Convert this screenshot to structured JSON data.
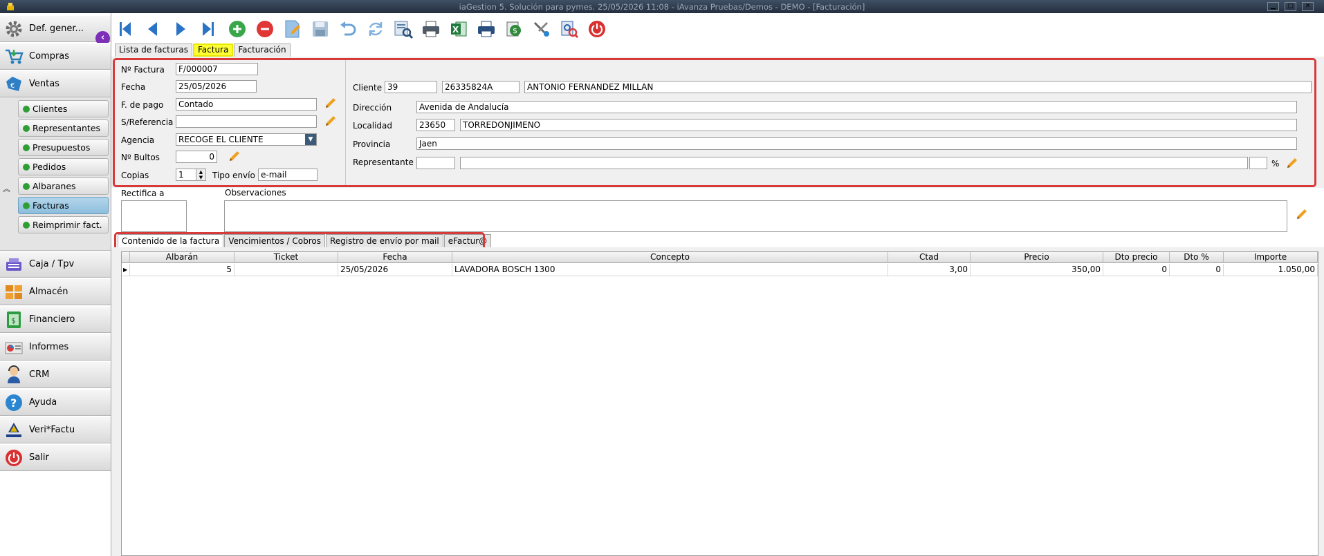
{
  "window": {
    "title": "iaGestion 5. Solución para pymes.   25/05/2026 11:08   -   iAvanza Pruebas/Demos - DEMO - [Facturación]"
  },
  "sidebar": {
    "main_items": [
      {
        "label": "Def. gener...",
        "icon": "gear-icon"
      },
      {
        "label": "Compras",
        "icon": "cart-icon"
      },
      {
        "label": "Ventas",
        "icon": "sales-icon"
      },
      {
        "label": "Caja / Tpv",
        "icon": "cash-register-icon"
      },
      {
        "label": "Almacén",
        "icon": "warehouse-icon"
      },
      {
        "label": "Financiero",
        "icon": "money-icon"
      },
      {
        "label": "Informes",
        "icon": "report-icon"
      },
      {
        "label": "CRM",
        "icon": "crm-person-icon"
      },
      {
        "label": "Ayuda",
        "icon": "help-icon"
      },
      {
        "label": "Veri*Factu",
        "icon": "verifactu-icon"
      },
      {
        "label": "Salir",
        "icon": "power-icon"
      }
    ],
    "ventas_subitems": [
      {
        "label": "Clientes"
      },
      {
        "label": "Representantes"
      },
      {
        "label": "Presupuestos"
      },
      {
        "label": "Pedidos"
      },
      {
        "label": "Albaranes"
      },
      {
        "label": "Facturas",
        "active": true
      },
      {
        "label": "Reimprimir fact."
      }
    ]
  },
  "toolbar": {
    "buttons": [
      "first-record-icon",
      "prev-record-icon",
      "next-record-icon",
      "last-record-icon",
      "add-icon",
      "delete-icon",
      "edit-icon",
      "save-icon",
      "undo-icon",
      "refresh-icon",
      "search-list-icon",
      "print-icon",
      "excel-icon",
      "printer-alt-icon",
      "invoice-money-icon",
      "tools-icon",
      "settings-search-icon",
      "exit-power-icon"
    ]
  },
  "doc_tabs": [
    {
      "label": "Lista de facturas"
    },
    {
      "label": "Factura",
      "active": true
    },
    {
      "label": "Facturación"
    }
  ],
  "form": {
    "n_factura_label": "Nº Factura",
    "n_factura": "F/000007",
    "fecha_label": "Fecha",
    "fecha": "25/05/2026",
    "f_pago_label": "F. de pago",
    "f_pago": "Contado",
    "s_referencia_label": "S/Referencia",
    "s_referencia": "",
    "agencia_label": "Agencia",
    "agencia": "RECOGE EL CLIENTE",
    "bultos_label": "Nº Bultos",
    "bultos": "0",
    "copias_label": "Copias",
    "copias": "1",
    "tipo_envio_label": "Tipo envío",
    "tipo_envio": "e-mail",
    "cliente_label": "Cliente",
    "cliente_codigo": "39",
    "cliente_nif": "26335824A",
    "cliente_nombre": "ANTONIO FERNANDEZ MILLAN",
    "direccion_label": "Dirección",
    "direccion": "Avenida de Andalucía",
    "localidad_label": "Localidad",
    "cp": "23650",
    "localidad": "TORREDONJIMENO",
    "provincia_label": "Provincia",
    "provincia": "Jaen",
    "representante_label": "Representante",
    "representante_codigo": "",
    "representante_nombre": "",
    "representante_pct": "",
    "pct_symbol": "%",
    "rectifica_label": "Rectifica a",
    "observaciones_label": "Observaciones",
    "observaciones": ""
  },
  "lower_tabs": [
    {
      "label": "Contenido de la factura",
      "active": true
    },
    {
      "label": "Vencimientos / Cobros"
    },
    {
      "label": "Registro de envío por mail"
    },
    {
      "label": "eFactur@"
    }
  ],
  "grid": {
    "columns": [
      "Albarán",
      "Ticket",
      "Fecha",
      "Concepto",
      "Ctad",
      "Precio",
      "Dto precio",
      "Dto %",
      "Importe"
    ],
    "rows": [
      [
        "5",
        "",
        "25/05/2026",
        "LAVADORA BOSCH 1300",
        "3,00",
        "350,00",
        "0",
        "0",
        "1.050,00"
      ]
    ]
  },
  "colors": {
    "highlight_box": "#d83a3a",
    "active_tab": "#ffff33",
    "active_nav": "#8dbedd"
  }
}
